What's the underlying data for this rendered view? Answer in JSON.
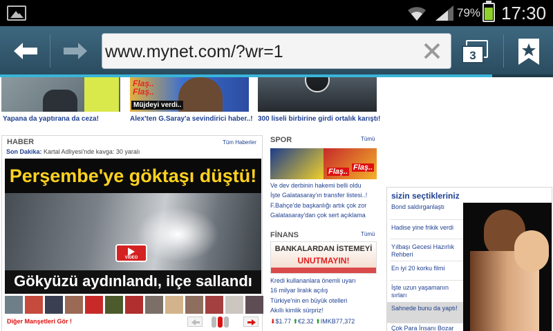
{
  "status_bar": {
    "battery_percent": "79%",
    "time": "17:30",
    "icons": [
      "image-notification-icon",
      "wifi-icon",
      "signal-icon",
      "battery-icon"
    ],
    "battery_level": 0.79
  },
  "browser": {
    "url": "www.mynet.com/?wr=1",
    "tab_count": "3",
    "load_progress": 0.89,
    "colors": {
      "toolbar": "#335a6e",
      "progress": "#38b5d8"
    }
  },
  "top_stories": [
    {
      "caption": "Yapana da yaptırana da ceza!"
    },
    {
      "caption": "Alex'ten G.Saray'a sevindirici haber..!",
      "overlay_lines": [
        "Flaş..",
        "Flaş..",
        "Müjdeyi verdi.."
      ]
    },
    {
      "caption": "300 liseli birbirine girdi ortalık karıştı!"
    }
  ],
  "haber": {
    "title": "HABER",
    "all_link": "Tüm Haberler",
    "breaking_label": "Son Dakika:",
    "breaking_text": "Kartal Adliyesi'nde kavga: 30 yaralı",
    "headline_top": "Perşembe'ye göktaşı düştü!",
    "headline_bottom": "Gökyüzü aydınlandı, ilçe sallandı",
    "video_label": "VIDEO",
    "more_link": "Diğer Manşetleri Gör !"
  },
  "spor": {
    "title": "SPOR",
    "all_link": "Tümü",
    "image_text": [
      "Flaş..",
      "Flaş.."
    ],
    "items": [
      "Ve dev derbinin hakemi belli oldu",
      "İşte Galatasaray'ın transfer listesi..!",
      "F.Bahçe'de başkanlığı artık çok zor",
      "Galatasaray'dan çok sert açıklama"
    ]
  },
  "finans": {
    "title": "FİNANS",
    "all_link": "Tümü",
    "banner_line1": "BANKALARDAN İSTEMEYİ",
    "banner_line2": "UNUTMAYIN!",
    "items": [
      "Kredi kullananlara önemli uyarı",
      "16 milyar liralık açılış",
      "Türkiye'nin en büyük otelleri",
      "Akıllı kimlik sürpriz!"
    ],
    "ticker": {
      "a": "$1.77",
      "b": "€2.32",
      "c": "IMKB77,372"
    }
  },
  "picks": {
    "title": "sizin seçtikleriniz",
    "items": [
      "Bond saldırganlaştı",
      "Hadise yine frikik verdi",
      "Yılbaşı Gecesi Hazırlık Rehberi",
      "En iyi 20 korku filmi",
      "İşte uzun yaşamanın sırları",
      "Sahnede bunu da yaptı!",
      "Çok Para İnsanı Bozar"
    ]
  }
}
